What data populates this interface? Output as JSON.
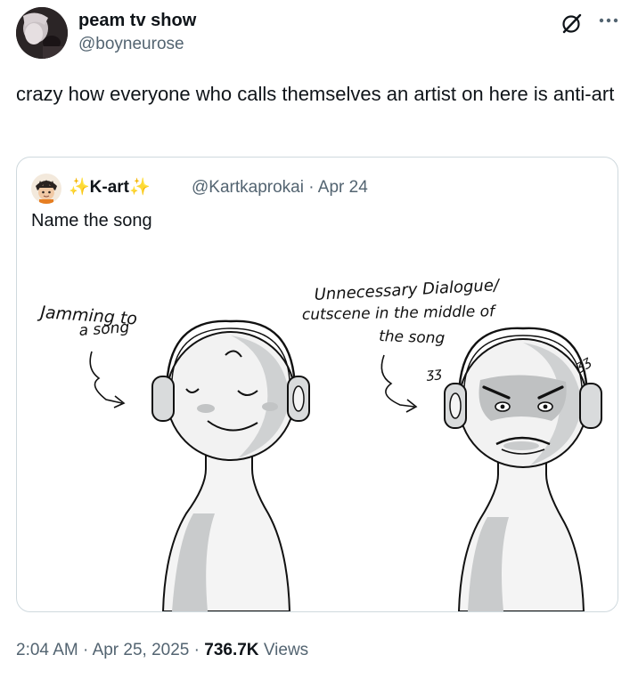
{
  "tweet": {
    "author": {
      "display_name": "peam tv show",
      "handle": "@boyneurose"
    },
    "text": "crazy how everyone who calls themselves an artist on here is anti-art",
    "time": "2:04 AM",
    "date": "Apr 25, 2025",
    "views_count": "736.7K",
    "views_label": "Views",
    "separator": "·"
  },
  "quoted_tweet": {
    "display_name_prefix": "✨",
    "display_name_core": "K-art",
    "display_name_suffix": "✨",
    "handle": "@Kartkaprokai",
    "date": "Apr 24",
    "separator": "·",
    "text": "Name the song",
    "image": {
      "left_caption_line1": "Jamming to",
      "left_caption_line2": "a song",
      "right_caption_line1": "Unnecessary Dialogue/",
      "right_caption_line2": "cutscene in the middle of",
      "right_caption_line3": "the song",
      "left_zzz": "ʒʒ",
      "right_zzz": "ʒʒ"
    }
  },
  "icons": {
    "grok": "grok-icon",
    "more": "more-icon"
  },
  "colors": {
    "text": "#0f1419",
    "secondary": "#536471",
    "border": "#cfd9de",
    "sparkle": "#f5b400"
  }
}
